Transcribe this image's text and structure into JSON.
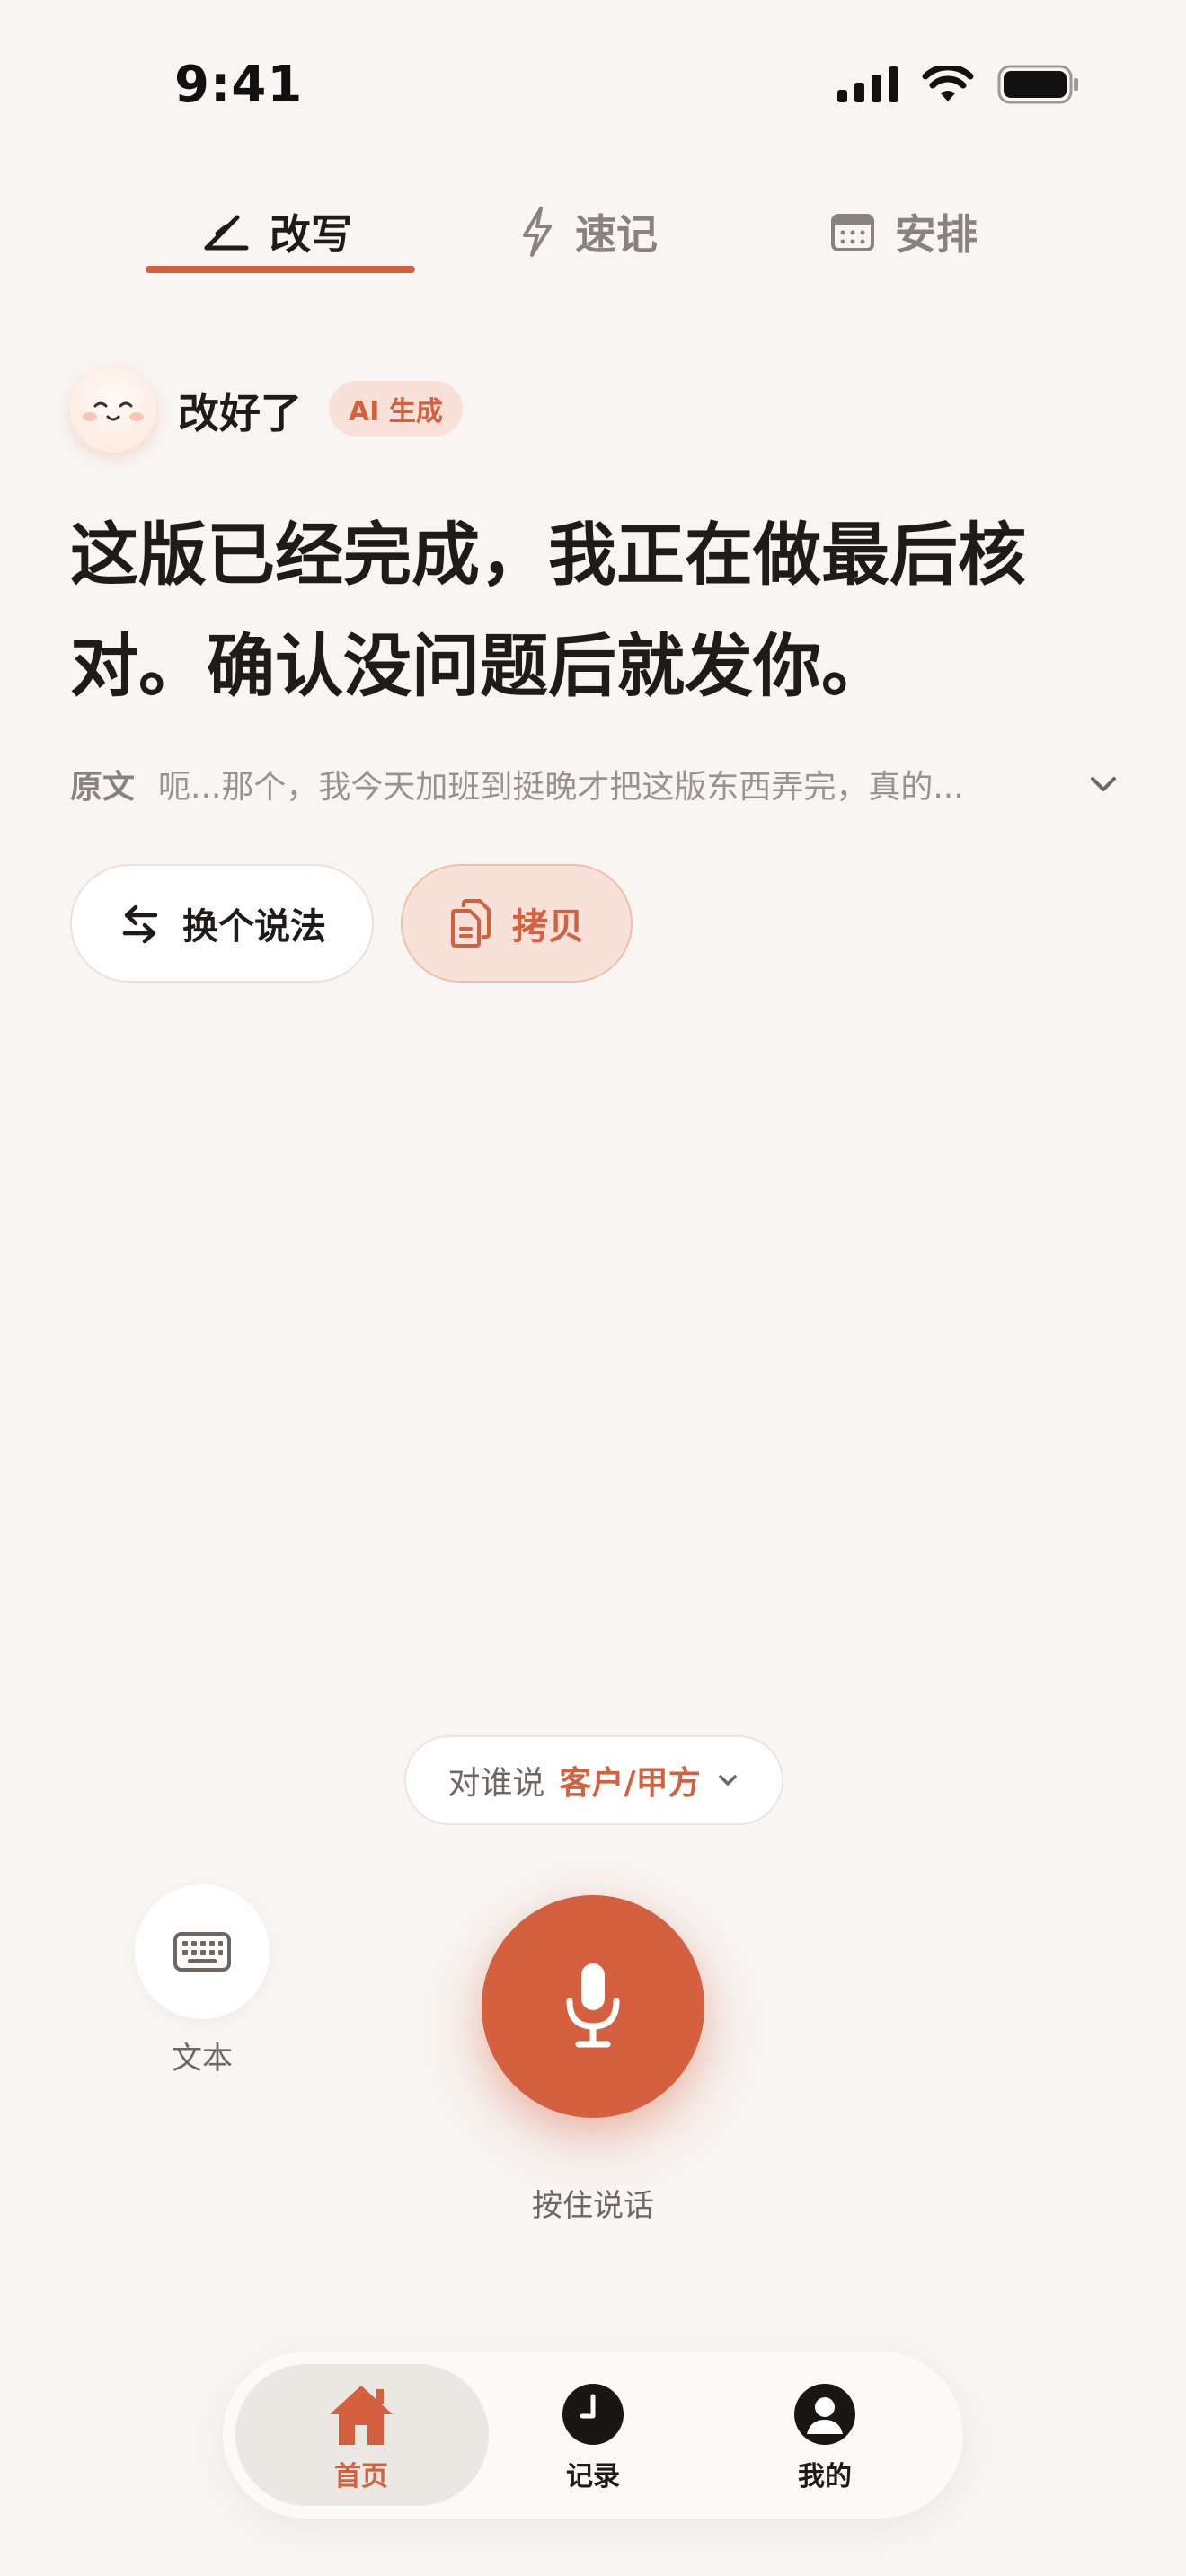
{
  "status_bar": {
    "time": "9:41"
  },
  "tabs": [
    {
      "label": "改写",
      "icon": "pen-icon",
      "active": true
    },
    {
      "label": "速记",
      "icon": "lightning-icon",
      "active": false
    },
    {
      "label": "安排",
      "icon": "calendar-icon",
      "active": false
    }
  ],
  "result": {
    "status": "改好了",
    "badge": "AI 生成",
    "text_line1": "这版已经完成，我正在做最后核",
    "text_line2": "对。确认没问题后就发你。",
    "original_label": "原文",
    "original_text": "呃...那个，我今天加班到挺晚才把这版东西弄完，真的..."
  },
  "actions": {
    "rephrase": "换个说法",
    "copy": "拷贝"
  },
  "recipient": {
    "label": "对谁说",
    "value": "客户/甲方"
  },
  "input": {
    "text_mode_label": "文本",
    "voice_label": "按住说话"
  },
  "nav": [
    {
      "label": "首页",
      "icon": "home-icon",
      "active": true
    },
    {
      "label": "记录",
      "icon": "clock-icon",
      "active": false
    },
    {
      "label": "我的",
      "icon": "profile-icon",
      "active": false
    }
  ],
  "colors": {
    "accent": "#d4603f",
    "background": "#f8f5f2",
    "badge_bg": "#f7e1d8"
  }
}
